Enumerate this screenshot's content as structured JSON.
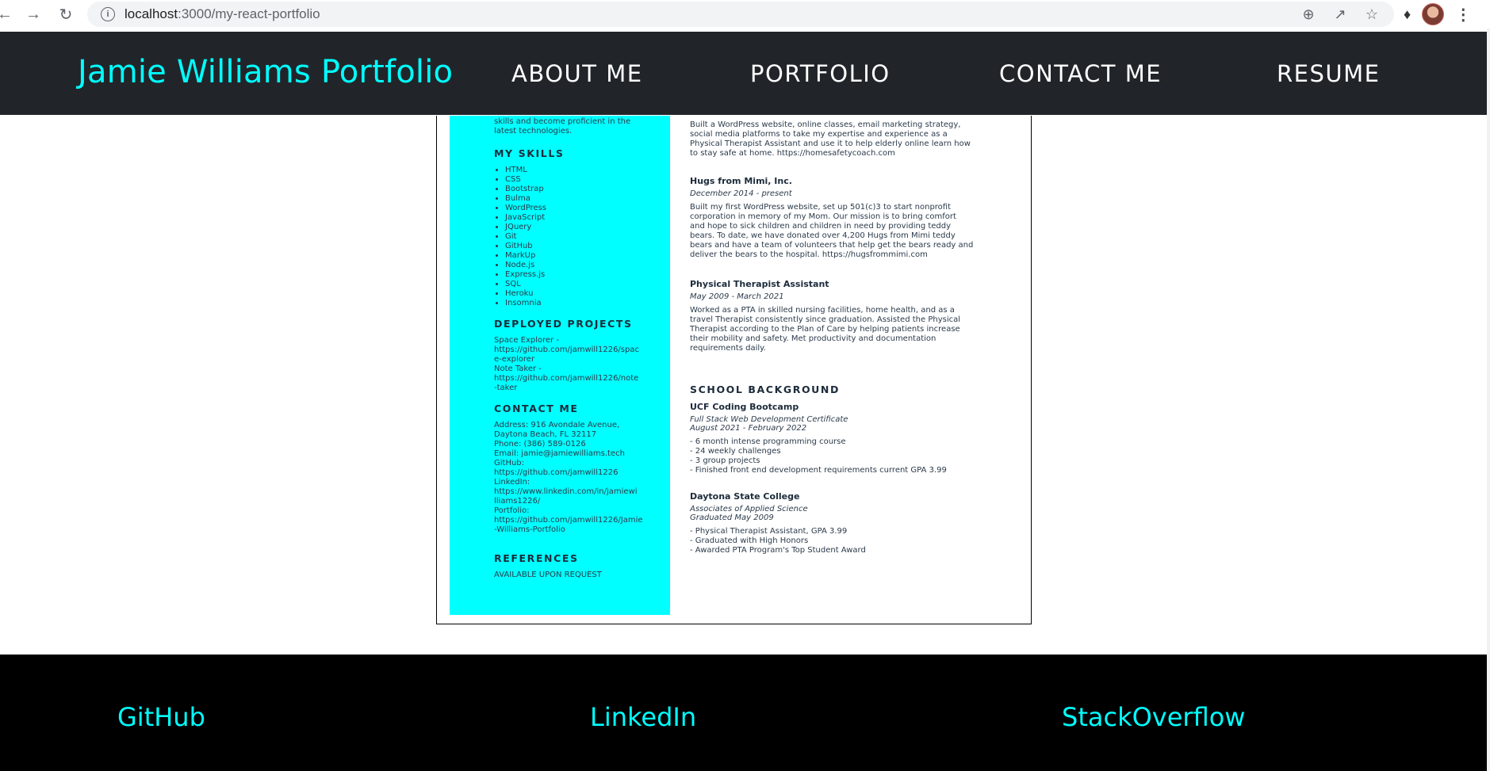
{
  "browser": {
    "url_host": "localhost",
    "url_path": ":3000/my-react-portfolio"
  },
  "header": {
    "brand": "Jamie Williams Portfolio",
    "nav": [
      "ABOUT ME",
      "PORTFOLIO",
      "CONTACT ME",
      "RESUME"
    ]
  },
  "resume": {
    "sidebar_intro": [
      "skills and become proficient in the",
      "latest technologies."
    ],
    "skills_heading": "MY SKILLS",
    "skills": [
      "HTML",
      "CSS",
      "Bootstrap",
      "Bulma",
      "WordPress",
      "JavaScript",
      "JQuery",
      "Git",
      "GitHub",
      "MarkUp",
      "Node.js",
      "Express.js",
      "SQL",
      "Heroku",
      "Insomnia"
    ],
    "projects_heading": "DEPLOYED PROJECTS",
    "projects": [
      "Space Explorer -",
      "https://github.com/jamwill1226/spac",
      "e-explorer",
      "Note Taker -",
      "https://github.com/jamwill1226/note",
      "-taker"
    ],
    "contact_heading": "CONTACT ME",
    "contact": [
      "Address: 916 Avondale Avenue,",
      "Daytona Beach, FL 32117",
      "Phone: (386) 589-0126",
      "Email: jamie@jamiewilliams.tech",
      "GitHub:",
      "https://github.com/jamwill1226",
      "LinkedIn:",
      "https://www.linkedin.com/in/jamiewi",
      "lliams1226/",
      "Portfolio:",
      "https://github.com/jamwill1226/Jamie",
      "-Williams-Portfolio"
    ],
    "references_heading": "REFERENCES",
    "references": "AVAILABLE UPON REQUEST",
    "first_job_desc": [
      "Built a WordPress website, online classes, email marketing strategy,",
      "social media platforms to take my expertise and experience as a",
      "Physical Therapist Assistant and use it to help elderly online learn how",
      "to stay safe at home. https://homesafetycoach.com"
    ],
    "jobs": [
      {
        "title": "Hugs from Mimi, Inc.",
        "date": "December 2014 - present",
        "desc": [
          "Built my first WordPress website, set up 501(c)3 to start nonprofit",
          "corporation in memory of my Mom. Our mission is to bring comfort",
          "and hope to sick children and children in need by providing teddy",
          "bears. To date, we have donated over 4,200 Hugs from Mimi teddy",
          "bears and have a team of volunteers that help get the bears ready and",
          "deliver the bears to the hospital. https://hugsfrommimi.com"
        ]
      },
      {
        "title": "Physical Therapist Assistant",
        "date": "May 2009 - March 2021",
        "desc": [
          "Worked as a PTA in skilled nursing facilities, home health, and as a",
          "travel Therapist consistently since graduation. Assisted the Physical",
          "Therapist according to the Plan of Care by helping patients increase",
          "their mobility and safety. Met productivity and documentation",
          "requirements daily."
        ]
      }
    ],
    "school_heading": "SCHOOL BACKGROUND",
    "schools": [
      {
        "name": "UCF Coding Bootcamp",
        "detail": [
          "Full Stack Web Development Certificate",
          "August 2021 - February 2022"
        ],
        "items": [
          "- 6 month intense programming course",
          "- 24 weekly challenges",
          "- 3 group projects",
          "- Finished front end development requirements current GPA 3.99"
        ]
      },
      {
        "name": "Daytona State College",
        "detail": [
          "Associates of Applied Science",
          "Graduated May 2009"
        ],
        "items": [
          "- Physical Therapist Assistant, GPA 3.99",
          "- Graduated with High Honors",
          "- Awarded PTA Program's Top Student Award"
        ]
      }
    ]
  },
  "footer": {
    "links": [
      "GitHub",
      "LinkedIn",
      "StackOverflow"
    ]
  }
}
